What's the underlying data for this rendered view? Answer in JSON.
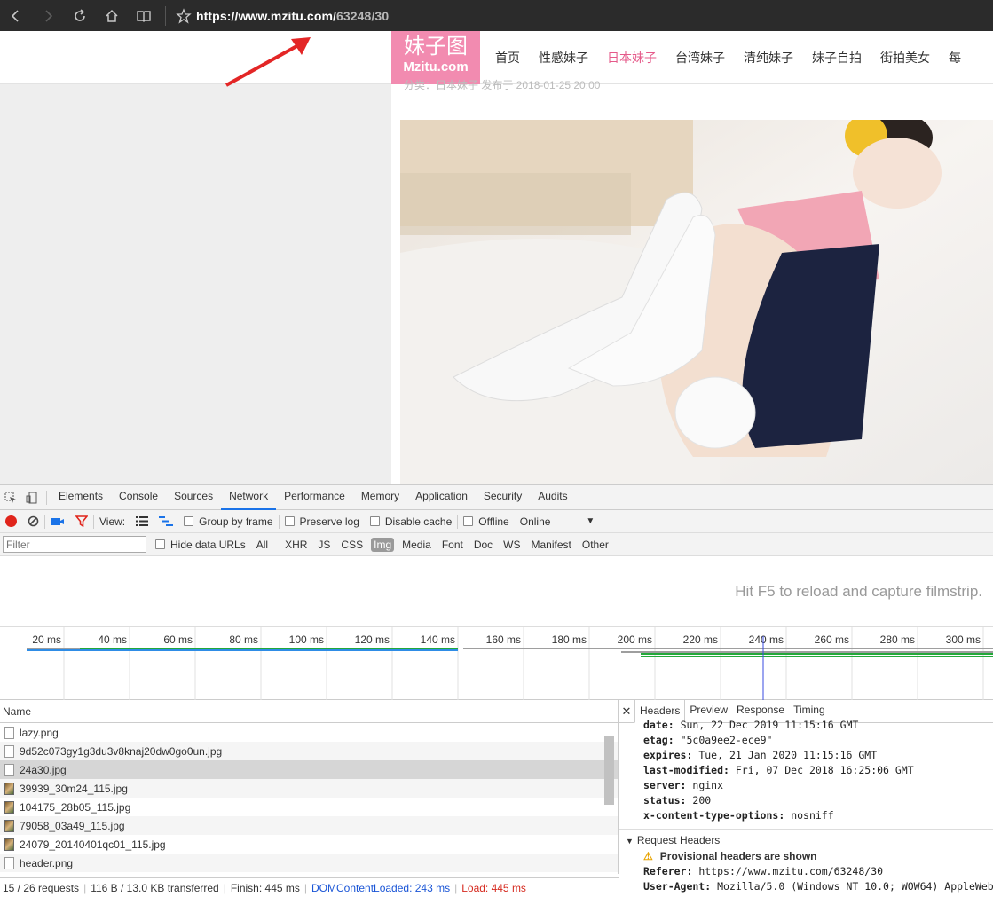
{
  "browser": {
    "url_host": "https://www.mzitu.com/",
    "url_path": "63248/30"
  },
  "site": {
    "logo_line1": "妹子图",
    "logo_line2": "Mzitu.com",
    "nav": [
      "首页",
      "性感妹子",
      "日本妹子",
      "台湾妹子",
      "清纯妹子",
      "妹子自拍",
      "街拍美女",
      "每"
    ],
    "active_nav": "日本妹子",
    "meta_text": "分类：日本妹子  发布于 2018-01-25 20:00"
  },
  "devtools": {
    "tabs": [
      "Elements",
      "Console",
      "Sources",
      "Network",
      "Performance",
      "Memory",
      "Application",
      "Security",
      "Audits"
    ],
    "active_tab": "Network",
    "toolbar": {
      "view_label": "View:",
      "group_by_frame": "Group by frame",
      "preserve_log": "Preserve log",
      "disable_cache": "Disable cache",
      "offline": "Offline",
      "throttle": "Online"
    },
    "filter": {
      "placeholder": "Filter",
      "hide_data_urls": "Hide data URLs",
      "types": [
        "All",
        "XHR",
        "JS",
        "CSS",
        "Img",
        "Media",
        "Font",
        "Doc",
        "WS",
        "Manifest",
        "Other"
      ],
      "active_type": "Img"
    },
    "filmstrip_message": "Hit F5 to reload and capture filmstrip.",
    "timeline_ticks": [
      "20 ms",
      "40 ms",
      "60 ms",
      "80 ms",
      "100 ms",
      "120 ms",
      "140 ms",
      "160 ms",
      "180 ms",
      "200 ms",
      "220 ms",
      "240 ms",
      "260 ms",
      "280 ms",
      "300 ms"
    ],
    "list_header": "Name",
    "requests": [
      {
        "name": "lazy.png",
        "icon": "blank"
      },
      {
        "name": "9d52c073gy1g3du3v8knaj20dw0go0un.jpg",
        "icon": "doc"
      },
      {
        "name": "24a30.jpg",
        "icon": "doc",
        "selected": true
      },
      {
        "name": "39939_30m24_115.jpg",
        "icon": "img"
      },
      {
        "name": "104175_28b05_115.jpg",
        "icon": "img"
      },
      {
        "name": "79058_03a49_115.jpg",
        "icon": "img"
      },
      {
        "name": "24079_20140401qc01_115.jpg",
        "icon": "img"
      },
      {
        "name": "header.png",
        "icon": "blank"
      }
    ],
    "status": {
      "requests": "15 / 26 requests",
      "transferred": "116 B / 13.0 KB transferred",
      "finish": "Finish: 445 ms",
      "domcontentloaded": "DOMContentLoaded: 243 ms",
      "load": "Load: 445 ms"
    },
    "headers_pane": {
      "tabs": [
        "Headers",
        "Preview",
        "Response",
        "Timing"
      ],
      "active_tab": "Headers",
      "response_headers": [
        {
          "k": "date:",
          "v": "Sun, 22 Dec 2019 11:15:16 GMT"
        },
        {
          "k": "etag:",
          "v": "\"5c0a9ee2-ece9\""
        },
        {
          "k": "expires:",
          "v": "Tue, 21 Jan 2020 11:15:16 GMT"
        },
        {
          "k": "last-modified:",
          "v": "Fri, 07 Dec 2018 16:25:06 GMT"
        },
        {
          "k": "server:",
          "v": "nginx"
        },
        {
          "k": "status:",
          "v": "200"
        },
        {
          "k": "x-content-type-options:",
          "v": "nosniff"
        }
      ],
      "request_section": "Request Headers",
      "provisional_warning": "Provisional headers are shown",
      "request_headers": [
        {
          "k": "Referer:",
          "v": "https://www.mzitu.com/63248/30"
        },
        {
          "k": "User-Agent:",
          "v": "Mozilla/5.0 (Windows NT 10.0; WOW64) AppleWebKit/"
        }
      ]
    }
  }
}
